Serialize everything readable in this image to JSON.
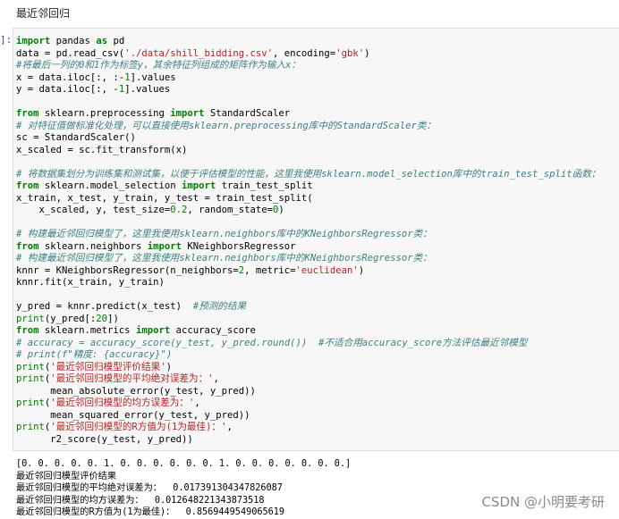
{
  "markdown": {
    "heading": "最近邻回归"
  },
  "cell": {
    "prompt": "]:"
  },
  "code_lines": [
    "import pandas as pd",
    "data = pd.read_csv('./data/shill_bidding.csv', encoding='gbk')",
    "#将最后一列的0和1作为标签y，其余特征列组成的矩阵作为输入x：",
    "x = data.iloc[:, :-1].values",
    "y = data.iloc[:, -1].values",
    "",
    "from sklearn.preprocessing import StandardScaler",
    "# 对特征值做标准化处理，可以直接使用sklearn.preprocessing库中的StandardScaler类：",
    "sc = StandardScaler()",
    "x_scaled = sc.fit_transform(x)",
    "",
    "# 将数据集划分为训练集和测试集，以便于评估模型的性能，这里我使用sklearn.model_selection库中的train_test_split函数：",
    "from sklearn.model_selection import train_test_split",
    "x_train, x_test, y_train, y_test = train_test_split(",
    "    x_scaled, y, test_size=0.2, random_state=0)",
    "",
    "# 构建最近邻回归模型了，这里我使用sklearn.neighbors库中的KNeighborsRegressor类：",
    "from sklearn.neighbors import KNeighborsRegressor",
    "# 构建最近邻回归模型了，这里我使用sklearn.neighbors库中的KNeighborsRegressor类：",
    "knnr = KNeighborsRegressor(n_neighbors=2, metric='euclidean')",
    "knnr.fit(x_train, y_train)",
    "",
    "y_pred = knnr.predict(x_test)  #预测的结果",
    "print(y_pred[:20])",
    "from sklearn.metrics import accuracy_score",
    "# accuracy = accuracy_score(y_test, y_pred.round())  #不适合用accuracy_score方法评估最近邻模型",
    "# print(f\"精度: {accuracy}\")",
    "print('最近邻回归模型评价结果')",
    "print('最近邻回归模型的平均绝对误差为：',",
    "      mean_absolute_error(y_test, y_pred))",
    "print('最近邻回归模型的均方误差为：',",
    "      mean_squared_error(y_test, y_pred))",
    "print('最近邻回归模型的R方值为(1为最佳)：',",
    "      r2_score(y_test, y_pred))"
  ],
  "output_lines": [
    "[0. 0. 0. 0. 0. 1. 0. 0. 0. 0. 0. 0. 1. 0. 0. 0. 0. 0. 0. 0.]",
    "最近邻回归模型评价结果",
    "最近邻回归模型的平均绝对误差为：  0.017391304347826087",
    "最近邻回归模型的均方误差为：  0.012648221343873518",
    "最近邻回归模型的R方值为(1为最佳)：  0.8569449549065619"
  ],
  "watermark": "CSDN @小明要考研"
}
